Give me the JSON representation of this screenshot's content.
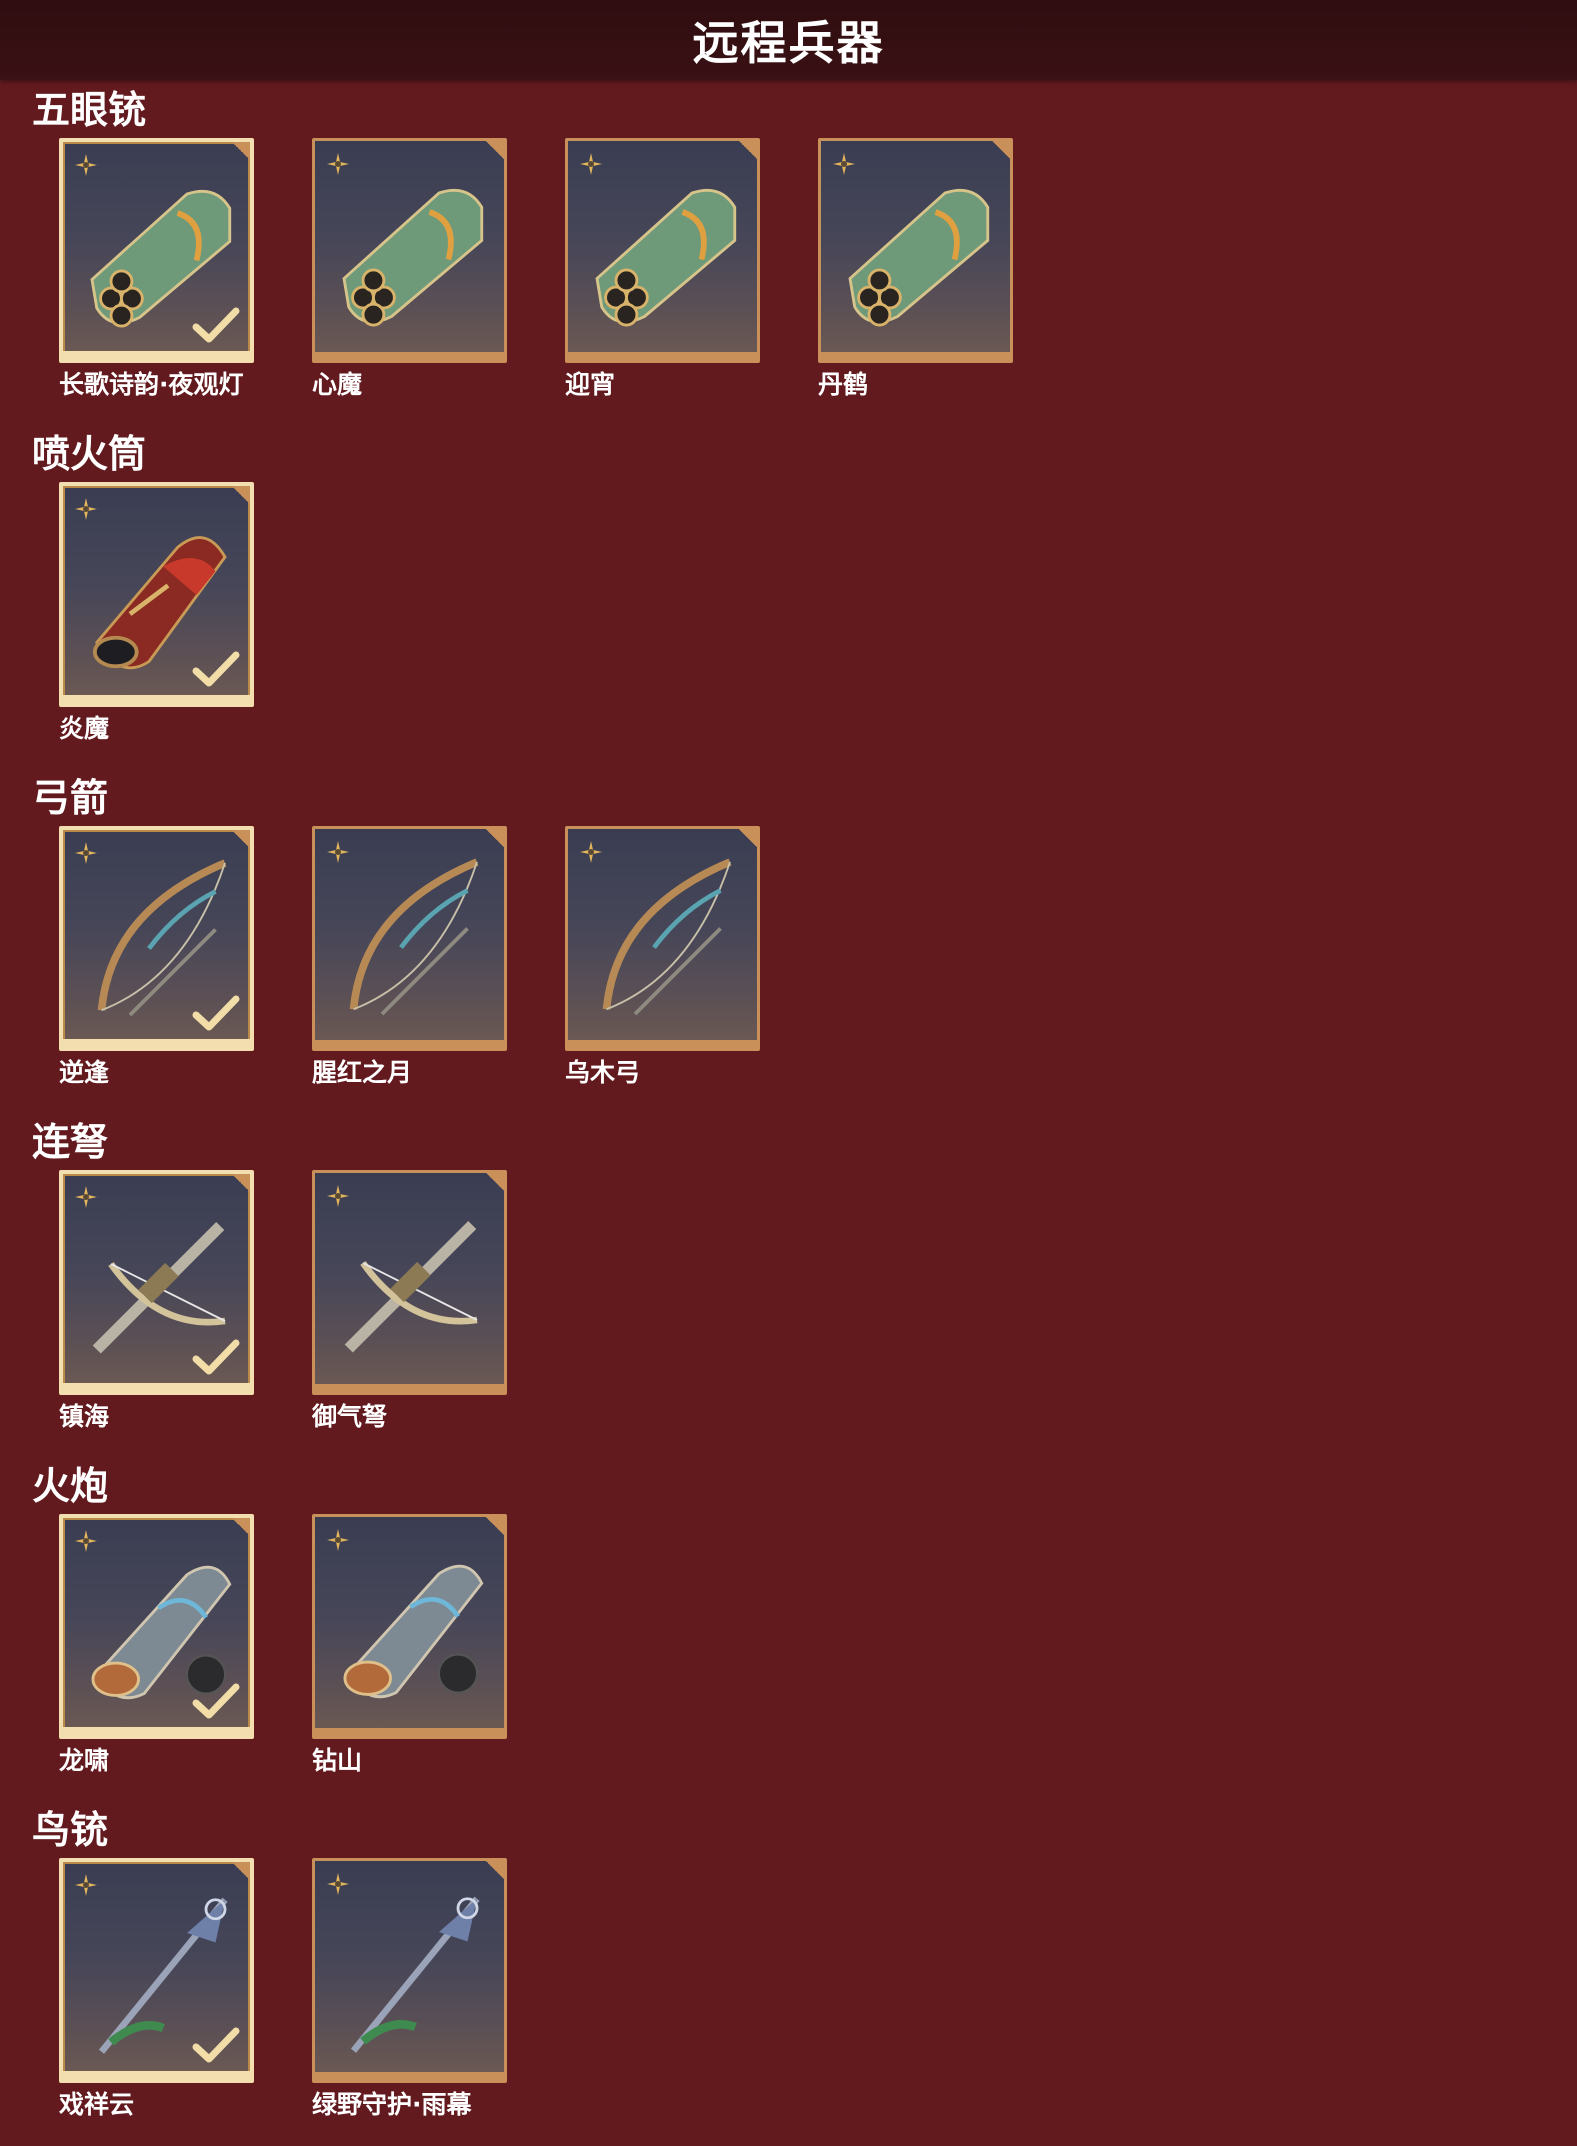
{
  "page": {
    "title": "远程兵器"
  },
  "colors": {
    "background": "#621a1f",
    "title_bar": "#2f0d10",
    "card_border": "#c9905a",
    "card_border_selected": "#f3deb0",
    "rarity_icon": "#e3b65c"
  },
  "sections": [
    {
      "title": "五眼铳",
      "items": [
        {
          "label": "长歌诗韵·夜观灯",
          "owned": true,
          "icon": "five-barrel-gun-icon"
        },
        {
          "label": "心魔",
          "owned": false,
          "icon": "five-barrel-gun-icon"
        },
        {
          "label": "迎宵",
          "owned": false,
          "icon": "five-barrel-gun-icon"
        },
        {
          "label": "丹鹤",
          "owned": false,
          "icon": "five-barrel-gun-icon"
        }
      ]
    },
    {
      "title": "喷火筒",
      "items": [
        {
          "label": "炎魔",
          "owned": true,
          "icon": "flamethrower-icon"
        }
      ]
    },
    {
      "title": "弓箭",
      "items": [
        {
          "label": "逆逢",
          "owned": true,
          "icon": "bow-icon"
        },
        {
          "label": "腥红之月",
          "owned": false,
          "icon": "bow-icon"
        },
        {
          "label": "乌木弓",
          "owned": false,
          "icon": "bow-icon"
        }
      ]
    },
    {
      "title": "连弩",
      "items": [
        {
          "label": "镇海",
          "owned": true,
          "icon": "crossbow-icon"
        },
        {
          "label": "御气弩",
          "owned": false,
          "icon": "crossbow-icon"
        }
      ]
    },
    {
      "title": "火炮",
      "items": [
        {
          "label": "龙啸",
          "owned": true,
          "icon": "cannon-icon"
        },
        {
          "label": "钻山",
          "owned": false,
          "icon": "cannon-icon"
        }
      ]
    },
    {
      "title": "鸟铳",
      "items": [
        {
          "label": "戏祥云",
          "owned": true,
          "icon": "musket-icon"
        },
        {
          "label": "绿野守护·雨幕",
          "owned": false,
          "icon": "musket-icon"
        }
      ]
    }
  ]
}
